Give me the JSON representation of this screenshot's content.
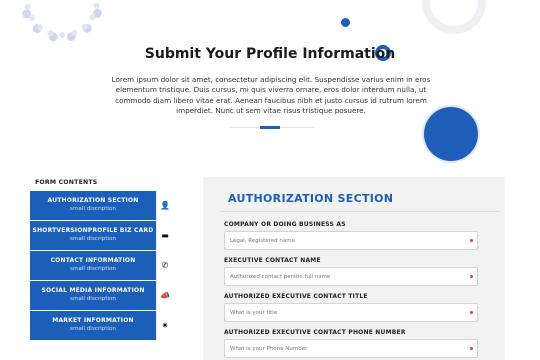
{
  "header": {
    "title": "Submit Your Profile Information",
    "intro": "Lorem ipsum dolor sit amet, consectetur adipiscing elit. Suspendisse varius enim in eros elementum tristique. Duis cursus, mi quis viverra ornare, eros dolor interdum nulla, ut commodo diam libero vitae erat. Aenean faucibus nibh et justo cursus id rutrum lorem imperdiet. Nunc ut sem vitae risus tristique posuere."
  },
  "sidebar": {
    "heading": "FORM CONTENTS",
    "items": [
      {
        "label": "AUTHORIZATION SECTION",
        "sub": "small discription",
        "icon": "person-icon",
        "glyph": "👤"
      },
      {
        "label": "SHORTVERSIONPROFILE BIZ CARD",
        "sub": "small discription",
        "icon": "card-icon",
        "glyph": "▬"
      },
      {
        "label": "CONTACT INFORMATION",
        "sub": "small discription",
        "icon": "phone-icon",
        "glyph": "✆"
      },
      {
        "label": "SOCIAL MEDIA INFORMATION",
        "sub": "small discription",
        "icon": "megaphone-icon",
        "glyph": "📣"
      },
      {
        "label": "MARKET INFORMATION",
        "sub": "small discription",
        "icon": "sparkle-icon",
        "glyph": "✷"
      }
    ]
  },
  "form": {
    "section_title": "AUTHORIZATION SECTION",
    "fields": [
      {
        "label": "COMPANY OR DOING BUSINESS AS",
        "placeholder": "Legal, Registered name"
      },
      {
        "label": "EXECUTIVE CONTACT NAME",
        "placeholder": "Authorized contact person full name"
      },
      {
        "label": "AUTHORIZED EXECUTIVE CONTACT TITLE",
        "placeholder": "What is your title"
      },
      {
        "label": "AUTHORIZED EXECUTIVE CONTACT PHONE NUMBER",
        "placeholder": "What is your Phone Number"
      }
    ]
  },
  "colors": {
    "accent": "#1c5fb8",
    "required": "#e23b3b",
    "panel": "#f2f2f2"
  }
}
